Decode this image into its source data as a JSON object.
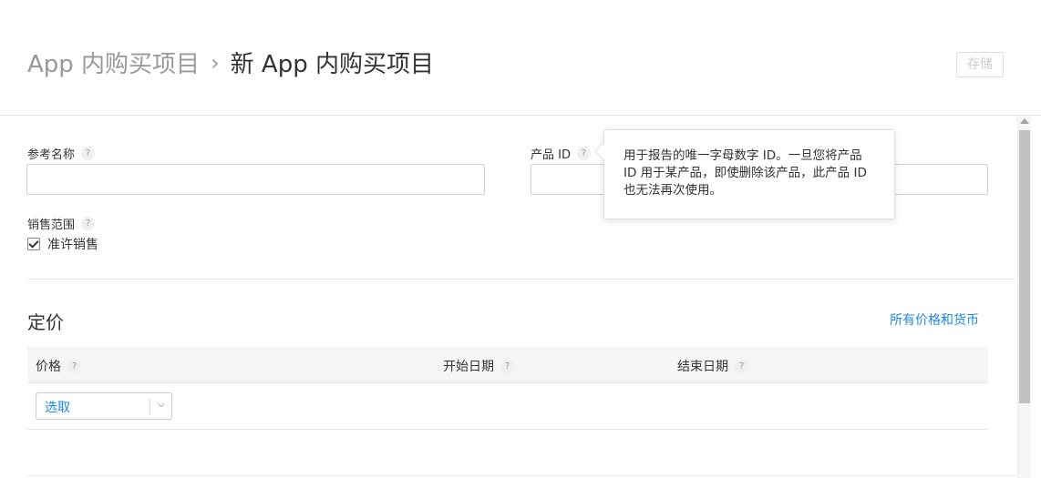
{
  "breadcrumb": {
    "parent": "App 内购买项目",
    "separator": "›",
    "current": "新 App 内购买项目"
  },
  "toolbar": {
    "save_label": "存储"
  },
  "form": {
    "reference_name": {
      "label": "参考名称",
      "help": "?",
      "value": ""
    },
    "product_id": {
      "label": "产品 ID",
      "help": "?",
      "value": ""
    },
    "availability": {
      "label": "销售范围",
      "help": "?",
      "checkbox_label": "准许销售",
      "checked": true
    }
  },
  "tooltip": {
    "text": "用于报告的唯一字母数字 ID。一旦您将产品 ID 用于某产品，即使删除该产品，此产品 ID 也无法再次使用。"
  },
  "pricing": {
    "title": "定价",
    "all_prices_link": "所有价格和货币",
    "columns": [
      {
        "label": "价格",
        "help": "?"
      },
      {
        "label": "开始日期",
        "help": "?"
      },
      {
        "label": "结束日期",
        "help": "?"
      }
    ],
    "price_select": {
      "value": "选取"
    }
  },
  "colors": {
    "accent": "#1e88e5",
    "muted": "#999999",
    "border": "#e5e5e5"
  }
}
